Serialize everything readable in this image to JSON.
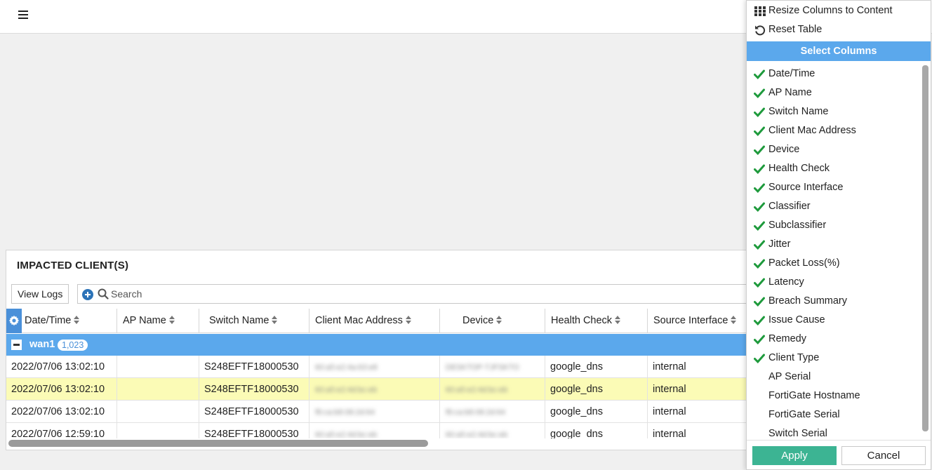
{
  "panel": {
    "title": "IMPACTED CLIENT(S)",
    "view_logs_label": "View Logs",
    "search_placeholder": "Search"
  },
  "table": {
    "columns": [
      "Date/Time",
      "AP Name",
      "Switch Name",
      "Client Mac Address",
      "Device",
      "Health Check",
      "Source Interface"
    ],
    "group": {
      "name": "wan1",
      "count": "1,023"
    },
    "rows": [
      {
        "datetime": "2022/07/06 13:02:10",
        "ap_name": "",
        "switch_name": "S248EFTF18000530",
        "mac": "60:a5:e2:4a:63:e8",
        "device": "DESKTOP-TJFSKTO",
        "health_check": "google_dns",
        "source_interface": "internal",
        "highlighted": false
      },
      {
        "datetime": "2022/07/06 13:02:10",
        "ap_name": "",
        "switch_name": "S248EFTF18000530",
        "mac": "60:a5:e2:4d:bc:eb",
        "device": "60:a5:e2:4d:bc:eb",
        "health_check": "google_dns",
        "source_interface": "internal",
        "highlighted": true
      },
      {
        "datetime": "2022/07/06 13:02:10",
        "ap_name": "",
        "switch_name": "S248EFTF18000530",
        "mac": "f8:ca:b8:08:2d:64",
        "device": "f8:ca:b8:08:2d:64",
        "health_check": "google_dns",
        "source_interface": "internal",
        "highlighted": false
      },
      {
        "datetime": "2022/07/06 12:59:10",
        "ap_name": "",
        "switch_name": "S248EFTF18000530",
        "mac": "60:a5:e2:4d:bc:eb",
        "device": "60:a5:e2:4d:bc:eb",
        "health_check": "google_dns",
        "source_interface": "internal",
        "highlighted": false
      }
    ]
  },
  "menu": {
    "resize_label": "Resize Columns to Content",
    "reset_label": "Reset Table",
    "select_columns_header": "Select Columns",
    "columns": [
      {
        "label": "Date/Time",
        "checked": true
      },
      {
        "label": "AP Name",
        "checked": true
      },
      {
        "label": "Switch Name",
        "checked": true
      },
      {
        "label": "Client Mac Address",
        "checked": true
      },
      {
        "label": "Device",
        "checked": true
      },
      {
        "label": "Health Check",
        "checked": true
      },
      {
        "label": "Source Interface",
        "checked": true
      },
      {
        "label": "Classifier",
        "checked": true
      },
      {
        "label": "Subclassifier",
        "checked": true
      },
      {
        "label": "Jitter",
        "checked": true
      },
      {
        "label": "Packet Loss(%)",
        "checked": true
      },
      {
        "label": "Latency",
        "checked": true
      },
      {
        "label": "Breach Summary",
        "checked": true
      },
      {
        "label": "Issue Cause",
        "checked": true
      },
      {
        "label": "Remedy",
        "checked": true
      },
      {
        "label": "Client Type",
        "checked": true
      },
      {
        "label": "AP Serial",
        "checked": false
      },
      {
        "label": "FortiGate Hostname",
        "checked": false
      },
      {
        "label": "FortiGate Serial",
        "checked": false
      },
      {
        "label": "Switch Serial",
        "checked": false
      }
    ],
    "apply_label": "Apply",
    "cancel_label": "Cancel"
  },
  "colors": {
    "accent_blue": "#5ba8ec",
    "apply_green": "#3cb493",
    "check_green": "#1e9a3c",
    "row_highlight": "#fbfbb6"
  }
}
